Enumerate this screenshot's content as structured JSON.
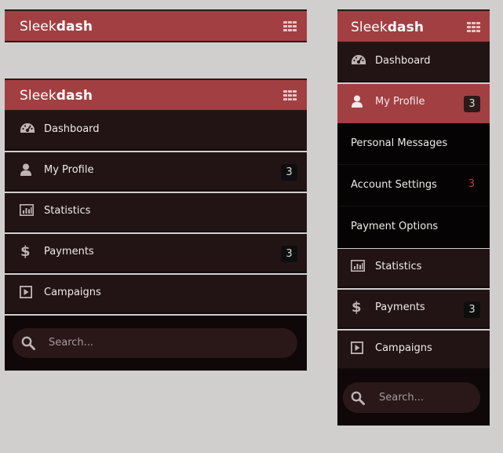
{
  "brand": {
    "prefix": "Sleek",
    "bold": "dash"
  },
  "menu": {
    "dashboard": "Dashboard",
    "profile": "My Profile",
    "profile_badge": "3",
    "statistics": "Statistics",
    "payments": "Payments",
    "payments_badge": "3",
    "campaigns": "Campaigns"
  },
  "submenu": {
    "personal_messages": "Personal Messages",
    "account_settings": "Account Settings",
    "account_settings_count": "3",
    "payment_options": "Payment Options"
  },
  "search": {
    "placeholder": "Search..."
  },
  "colors": {
    "header": "#a23f42",
    "menu_bg": "#221415",
    "submenu_bg": "#050303",
    "footer_bg": "#0f0708",
    "page_bg": "#d1cfcd",
    "accent_count": "#c03a3a"
  },
  "icons": {
    "header": "grid-icon",
    "dashboard": "dashboard-icon",
    "profile": "user-icon",
    "statistics": "bar-chart-icon",
    "payments": "dollar-icon",
    "campaigns": "play-icon",
    "search": "search-icon"
  }
}
